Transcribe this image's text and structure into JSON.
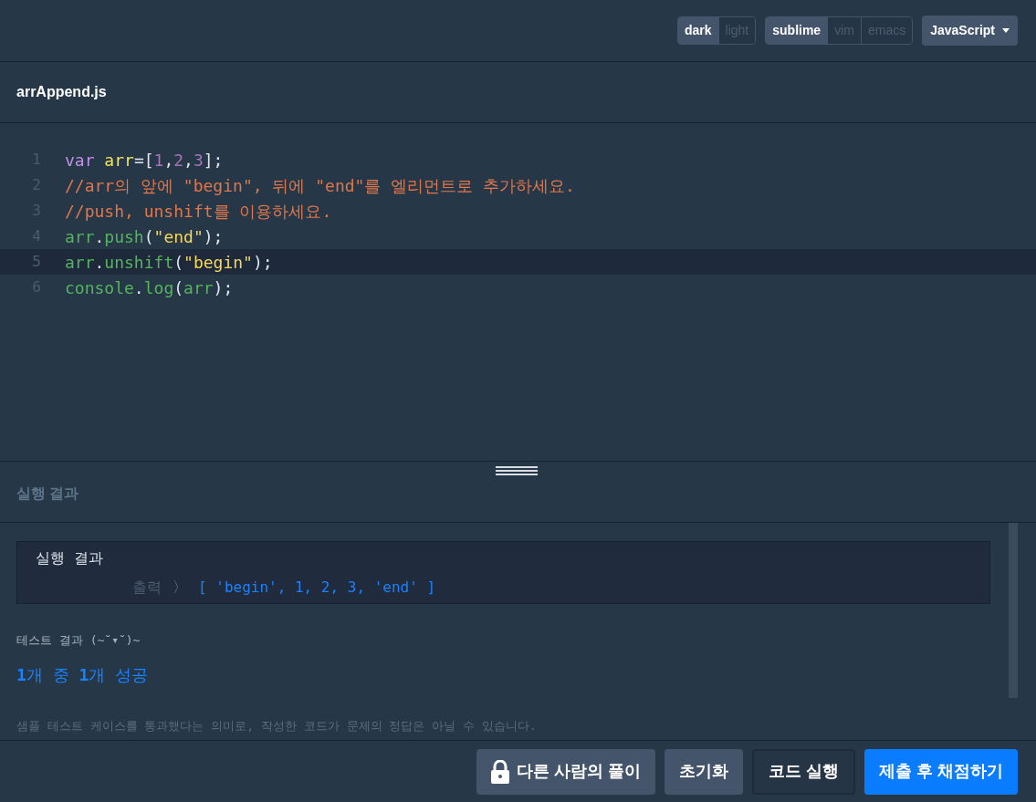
{
  "toolbar": {
    "themes": [
      {
        "label": "dark",
        "selected": true
      },
      {
        "label": "light",
        "selected": false
      }
    ],
    "keymaps": [
      {
        "label": "sublime",
        "selected": true
      },
      {
        "label": "vim",
        "selected": false
      },
      {
        "label": "emacs",
        "selected": false
      }
    ],
    "language": "JavaScript"
  },
  "file": {
    "name": "arrAppend.js"
  },
  "editor": {
    "lines": [
      {
        "number": "1",
        "active": false,
        "tokens": [
          {
            "kind": "keyword",
            "text": "var "
          },
          {
            "kind": "variable",
            "text": "arr"
          },
          {
            "kind": "plain",
            "text": "=["
          },
          {
            "kind": "number",
            "text": "1"
          },
          {
            "kind": "plain",
            "text": ","
          },
          {
            "kind": "number",
            "text": "2"
          },
          {
            "kind": "plain",
            "text": ","
          },
          {
            "kind": "number",
            "text": "3"
          },
          {
            "kind": "plain",
            "text": "];"
          }
        ]
      },
      {
        "number": "2",
        "active": false,
        "tokens": [
          {
            "kind": "comment",
            "text": "//arr의 앞에 \"begin\", 뒤에 \"end\"를 엘리먼트로 추가하세요."
          }
        ]
      },
      {
        "number": "3",
        "active": false,
        "tokens": [
          {
            "kind": "comment",
            "text": "//push, unshift를 이용하세요."
          }
        ]
      },
      {
        "number": "4",
        "active": false,
        "tokens": [
          {
            "kind": "ident",
            "text": "arr"
          },
          {
            "kind": "plain",
            "text": "."
          },
          {
            "kind": "ident",
            "text": "push"
          },
          {
            "kind": "plain",
            "text": "("
          },
          {
            "kind": "string",
            "text": "\"end\""
          },
          {
            "kind": "plain",
            "text": ");"
          }
        ]
      },
      {
        "number": "5",
        "active": true,
        "tokens": [
          {
            "kind": "ident",
            "text": "arr"
          },
          {
            "kind": "plain",
            "text": "."
          },
          {
            "kind": "ident",
            "text": "unshift"
          },
          {
            "kind": "plain",
            "text": "("
          },
          {
            "kind": "string",
            "text": "\"begin\""
          },
          {
            "kind": "plain",
            "text": ");"
          }
        ]
      },
      {
        "number": "6",
        "active": false,
        "tokens": [
          {
            "kind": "ident",
            "text": "console"
          },
          {
            "kind": "plain",
            "text": "."
          },
          {
            "kind": "ident",
            "text": "log"
          },
          {
            "kind": "plain",
            "text": "("
          },
          {
            "kind": "ident",
            "text": "arr"
          },
          {
            "kind": "plain",
            "text": ");"
          }
        ]
      }
    ]
  },
  "results": {
    "title": "실행 결과",
    "console": {
      "title": "실행 결과",
      "label": "출력",
      "arrow": "〉",
      "output": "[ 'begin', 1, 2, 3, 'end' ]"
    },
    "test_title": "테스트 결과 (~˘▾˘)~",
    "summary": "**1**개 중 **1**개 성공",
    "note": "샘플 테스트 케이스를 통과했다는 의미로, 작성한 코드가 문제의 정답은 아닐 수 있습니다."
  },
  "buttons": [
    {
      "kind": "locked",
      "label": "다른 사람의 풀이"
    },
    {
      "kind": "secondary",
      "label": "초기화"
    },
    {
      "kind": "dark",
      "label": "코드 실행"
    },
    {
      "kind": "primary",
      "label": "제출 후 채점하기"
    }
  ]
}
